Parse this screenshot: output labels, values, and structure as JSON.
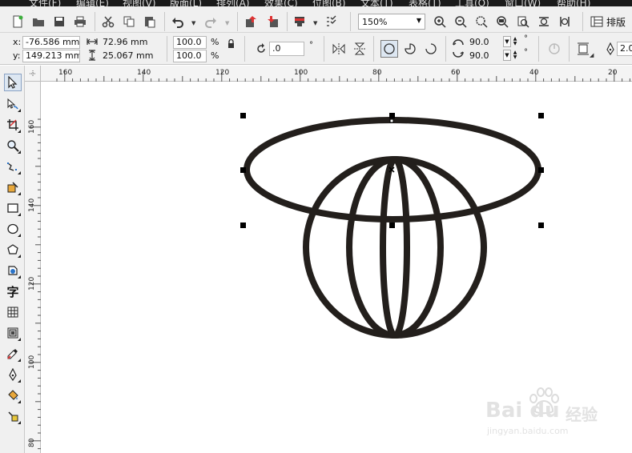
{
  "menu": [
    "文件(F)",
    "编辑(E)",
    "视图(V)",
    "版面(L)",
    "排列(A)",
    "效果(C)",
    "位图(B)",
    "文本(T)",
    "表格(T)",
    "工具(O)",
    "窗口(W)",
    "帮助(H)"
  ],
  "toolbar": {
    "zoom_value": "150%",
    "layout_label": "排版"
  },
  "properties": {
    "x_label": "x:",
    "x_value": "-76.586 mm",
    "y_label": "y:",
    "y_value": "149.213 mm",
    "width_value": "72.96 mm",
    "height_value": "25.067 mm",
    "scale_x": "100.0",
    "scale_y": "100.0",
    "percent": "%",
    "rotation_value": ".0",
    "degree": "°",
    "start_angle": "90.0",
    "end_angle": "90.0",
    "outline_width": "2.0"
  },
  "rulers": {
    "h_ticks": [
      "160",
      "140",
      "120",
      "100",
      "80",
      "60",
      "40",
      "20"
    ],
    "v_ticks": [
      "160",
      "140",
      "120",
      "100",
      "80"
    ]
  },
  "toolbox": {
    "text_tool_glyph": "字"
  },
  "watermark": {
    "brand": "Bai du",
    "suffix": "经验",
    "url": "jingyan.baidu.com"
  },
  "colors": {
    "stroke": "#231f1c",
    "toolbar_bg": "#f0f0f0",
    "active_bg": "#dde7f2"
  }
}
